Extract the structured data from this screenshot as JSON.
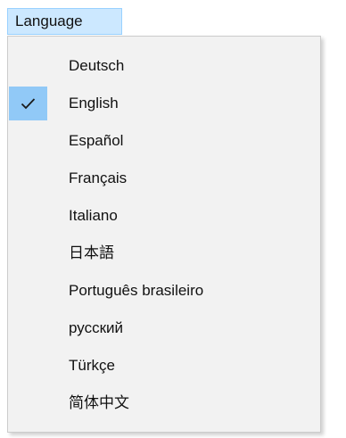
{
  "menubar": {
    "title": "Language"
  },
  "menu": {
    "items": [
      {
        "label": "Deutsch",
        "checked": false
      },
      {
        "label": "English",
        "checked": true
      },
      {
        "label": "Español",
        "checked": false
      },
      {
        "label": "Français",
        "checked": false
      },
      {
        "label": "Italiano",
        "checked": false
      },
      {
        "label": "日本語",
        "checked": false
      },
      {
        "label": "Português brasileiro",
        "checked": false
      },
      {
        "label": "русский",
        "checked": false
      },
      {
        "label": "Türkçe",
        "checked": false
      },
      {
        "label": "简体中文",
        "checked": false
      }
    ]
  },
  "colors": {
    "menu_title_highlight": "#cce8ff",
    "check_highlight": "#91c9f7",
    "dropdown_bg": "#f2f2f2"
  }
}
